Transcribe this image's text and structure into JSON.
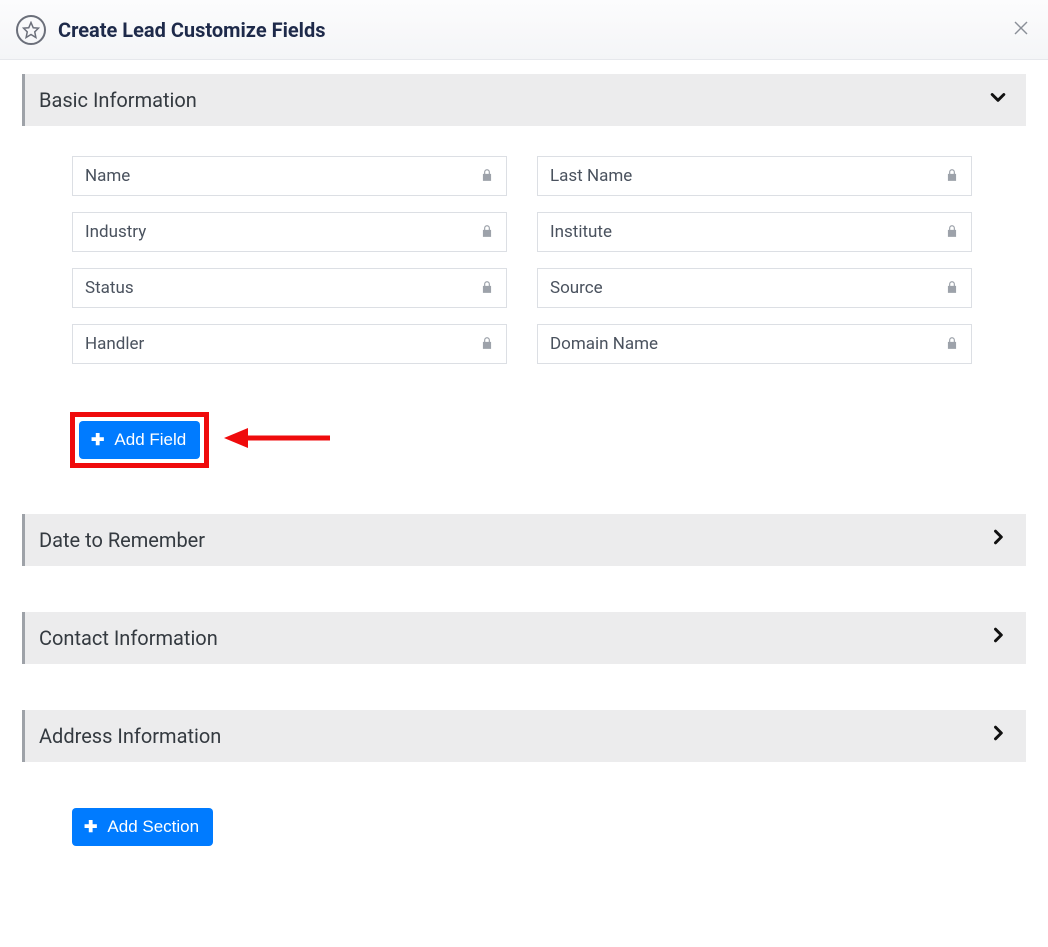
{
  "header": {
    "title": "Create Lead Customize Fields"
  },
  "sections": {
    "basic": {
      "title": "Basic Information",
      "expanded": true,
      "fields": [
        {
          "label": "Name",
          "locked": true
        },
        {
          "label": "Last Name",
          "locked": true
        },
        {
          "label": "Industry",
          "locked": true
        },
        {
          "label": "Institute",
          "locked": true
        },
        {
          "label": "Status",
          "locked": true
        },
        {
          "label": "Source",
          "locked": true
        },
        {
          "label": "Handler",
          "locked": true
        },
        {
          "label": "Domain Name",
          "locked": true
        }
      ]
    },
    "date": {
      "title": "Date to Remember",
      "expanded": false
    },
    "contact": {
      "title": "Contact Information",
      "expanded": false
    },
    "address": {
      "title": "Address Information",
      "expanded": false
    }
  },
  "buttons": {
    "add_field": "Add Field",
    "add_section": "Add Section"
  },
  "annotation": {
    "highlight": "add_field_button",
    "arrow_target": "add_field_button"
  }
}
